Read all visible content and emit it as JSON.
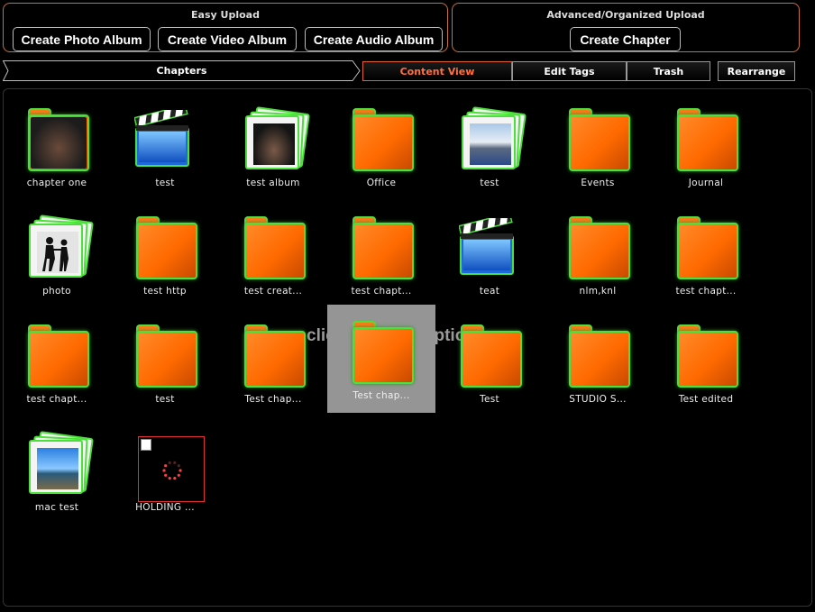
{
  "easy_upload": {
    "title": "Easy Upload",
    "buttons": [
      "Create Photo Album",
      "Create Video Album",
      "Create Audio Album"
    ]
  },
  "advanced_upload": {
    "title": "Advanced/Organized Upload",
    "button": "Create Chapter"
  },
  "nav": {
    "chapters": "Chapters",
    "tabs": [
      "Content View",
      "Edit Tags",
      "Trash"
    ],
    "active_tab": "Content View",
    "rearrange": "Rearrange"
  },
  "overlay_text": "click for more options",
  "items": [
    {
      "label": "chapter one",
      "type": "folder-photo"
    },
    {
      "label": "test",
      "type": "video"
    },
    {
      "label": "test album",
      "type": "album-people"
    },
    {
      "label": "Office",
      "type": "folder"
    },
    {
      "label": "test",
      "type": "album-boat"
    },
    {
      "label": "Events",
      "type": "folder"
    },
    {
      "label": "Journal",
      "type": "folder"
    },
    {
      "label": "photo",
      "type": "album-silhouette"
    },
    {
      "label": "test http",
      "type": "folder"
    },
    {
      "label": "test creat...",
      "type": "folder"
    },
    {
      "label": "test chapt...",
      "type": "folder"
    },
    {
      "label": "teat",
      "type": "video"
    },
    {
      "label": "nlm,knl",
      "type": "folder"
    },
    {
      "label": "test chapt...",
      "type": "folder"
    },
    {
      "label": "test chapt...",
      "type": "folder"
    },
    {
      "label": "test",
      "type": "folder"
    },
    {
      "label": "Test chap...",
      "type": "folder"
    },
    {
      "label": "Test chap...",
      "type": "folder",
      "hovered": true
    },
    {
      "label": "Test",
      "type": "folder"
    },
    {
      "label": "STUDIO S...",
      "type": "folder"
    },
    {
      "label": "Test edited",
      "type": "folder"
    },
    {
      "label": "mac test",
      "type": "album-ship"
    },
    {
      "label": "HOLDING ...",
      "type": "loading"
    }
  ],
  "colors": {
    "accent": "#e06030",
    "folder_orange": "#ff6a00",
    "folder_border": "#4ce03a",
    "panel_border": "#c8703a"
  }
}
